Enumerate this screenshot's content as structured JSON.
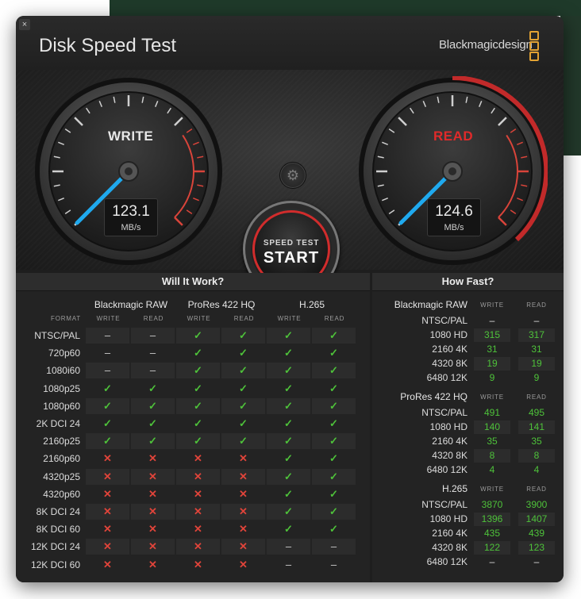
{
  "window": {
    "title": "Disk Speed Test",
    "brand": "Blackmagicdesign",
    "close_glyph": "×"
  },
  "gauges": {
    "write": {
      "label": "WRITE",
      "value": "123.1",
      "unit": "MB/s",
      "color": "#e8e8e8"
    },
    "read": {
      "label": "READ",
      "value": "124.6",
      "unit": "MB/s",
      "color": "#e02a2a"
    }
  },
  "settings": {
    "icon": "gear-icon",
    "glyph": "⚙"
  },
  "start": {
    "line1": "SPEED TEST",
    "line2": "START"
  },
  "will_it_work": {
    "heading": "Will It Work?",
    "format_label": "FORMAT",
    "groups": [
      "Blackmagic RAW",
      "ProRes 422 HQ",
      "H.265"
    ],
    "sub": [
      "WRITE",
      "READ"
    ],
    "rows": [
      {
        "format": "NTSC/PAL",
        "cells": [
          "–",
          "–",
          "✓",
          "✓",
          "✓",
          "✓"
        ]
      },
      {
        "format": "720p60",
        "cells": [
          "–",
          "–",
          "✓",
          "✓",
          "✓",
          "✓"
        ]
      },
      {
        "format": "1080i60",
        "cells": [
          "–",
          "–",
          "✓",
          "✓",
          "✓",
          "✓"
        ]
      },
      {
        "format": "1080p25",
        "cells": [
          "✓",
          "✓",
          "✓",
          "✓",
          "✓",
          "✓"
        ]
      },
      {
        "format": "1080p60",
        "cells": [
          "✓",
          "✓",
          "✓",
          "✓",
          "✓",
          "✓"
        ]
      },
      {
        "format": "2K DCI 24",
        "cells": [
          "✓",
          "✓",
          "✓",
          "✓",
          "✓",
          "✓"
        ]
      },
      {
        "format": "2160p25",
        "cells": [
          "✓",
          "✓",
          "✓",
          "✓",
          "✓",
          "✓"
        ]
      },
      {
        "format": "2160p60",
        "cells": [
          "✕",
          "✕",
          "✕",
          "✕",
          "✓",
          "✓"
        ]
      },
      {
        "format": "4320p25",
        "cells": [
          "✕",
          "✕",
          "✕",
          "✕",
          "✓",
          "✓"
        ]
      },
      {
        "format": "4320p60",
        "cells": [
          "✕",
          "✕",
          "✕",
          "✕",
          "✓",
          "✓"
        ]
      },
      {
        "format": "8K DCI 24",
        "cells": [
          "✕",
          "✕",
          "✕",
          "✕",
          "✓",
          "✓"
        ]
      },
      {
        "format": "8K DCI 60",
        "cells": [
          "✕",
          "✕",
          "✕",
          "✕",
          "✓",
          "✓"
        ]
      },
      {
        "format": "12K DCI 24",
        "cells": [
          "✕",
          "✕",
          "✕",
          "✕",
          "–",
          "–"
        ]
      },
      {
        "format": "12K DCI 60",
        "cells": [
          "✕",
          "✕",
          "✕",
          "✕",
          "–",
          "–"
        ]
      }
    ]
  },
  "how_fast": {
    "heading": "How Fast?",
    "sub": [
      "WRITE",
      "READ"
    ],
    "sections": [
      {
        "name": "Blackmagic RAW",
        "rows": [
          {
            "label": "NTSC/PAL",
            "write": "–",
            "read": "–"
          },
          {
            "label": "1080 HD",
            "write": "315",
            "read": "317"
          },
          {
            "label": "2160 4K",
            "write": "31",
            "read": "31"
          },
          {
            "label": "4320 8K",
            "write": "19",
            "read": "19"
          },
          {
            "label": "6480 12K",
            "write": "9",
            "read": "9"
          }
        ]
      },
      {
        "name": "ProRes 422 HQ",
        "rows": [
          {
            "label": "NTSC/PAL",
            "write": "491",
            "read": "495"
          },
          {
            "label": "1080 HD",
            "write": "140",
            "read": "141"
          },
          {
            "label": "2160 4K",
            "write": "35",
            "read": "35"
          },
          {
            "label": "4320 8K",
            "write": "8",
            "read": "8"
          },
          {
            "label": "6480 12K",
            "write": "4",
            "read": "4"
          }
        ]
      },
      {
        "name": "H.265",
        "rows": [
          {
            "label": "NTSC/PAL",
            "write": "3870",
            "read": "3900"
          },
          {
            "label": "1080 HD",
            "write": "1396",
            "read": "1407"
          },
          {
            "label": "2160 4K",
            "write": "435",
            "read": "439"
          },
          {
            "label": "4320 8K",
            "write": "122",
            "read": "123"
          },
          {
            "label": "6480 12K",
            "write": "–",
            "read": "–"
          }
        ]
      }
    ]
  },
  "colors": {
    "accent_green": "#4ec23a",
    "accent_red": "#e0443a",
    "needle_blue": "#1fa9ee",
    "brand_orange": "#e2a233"
  }
}
